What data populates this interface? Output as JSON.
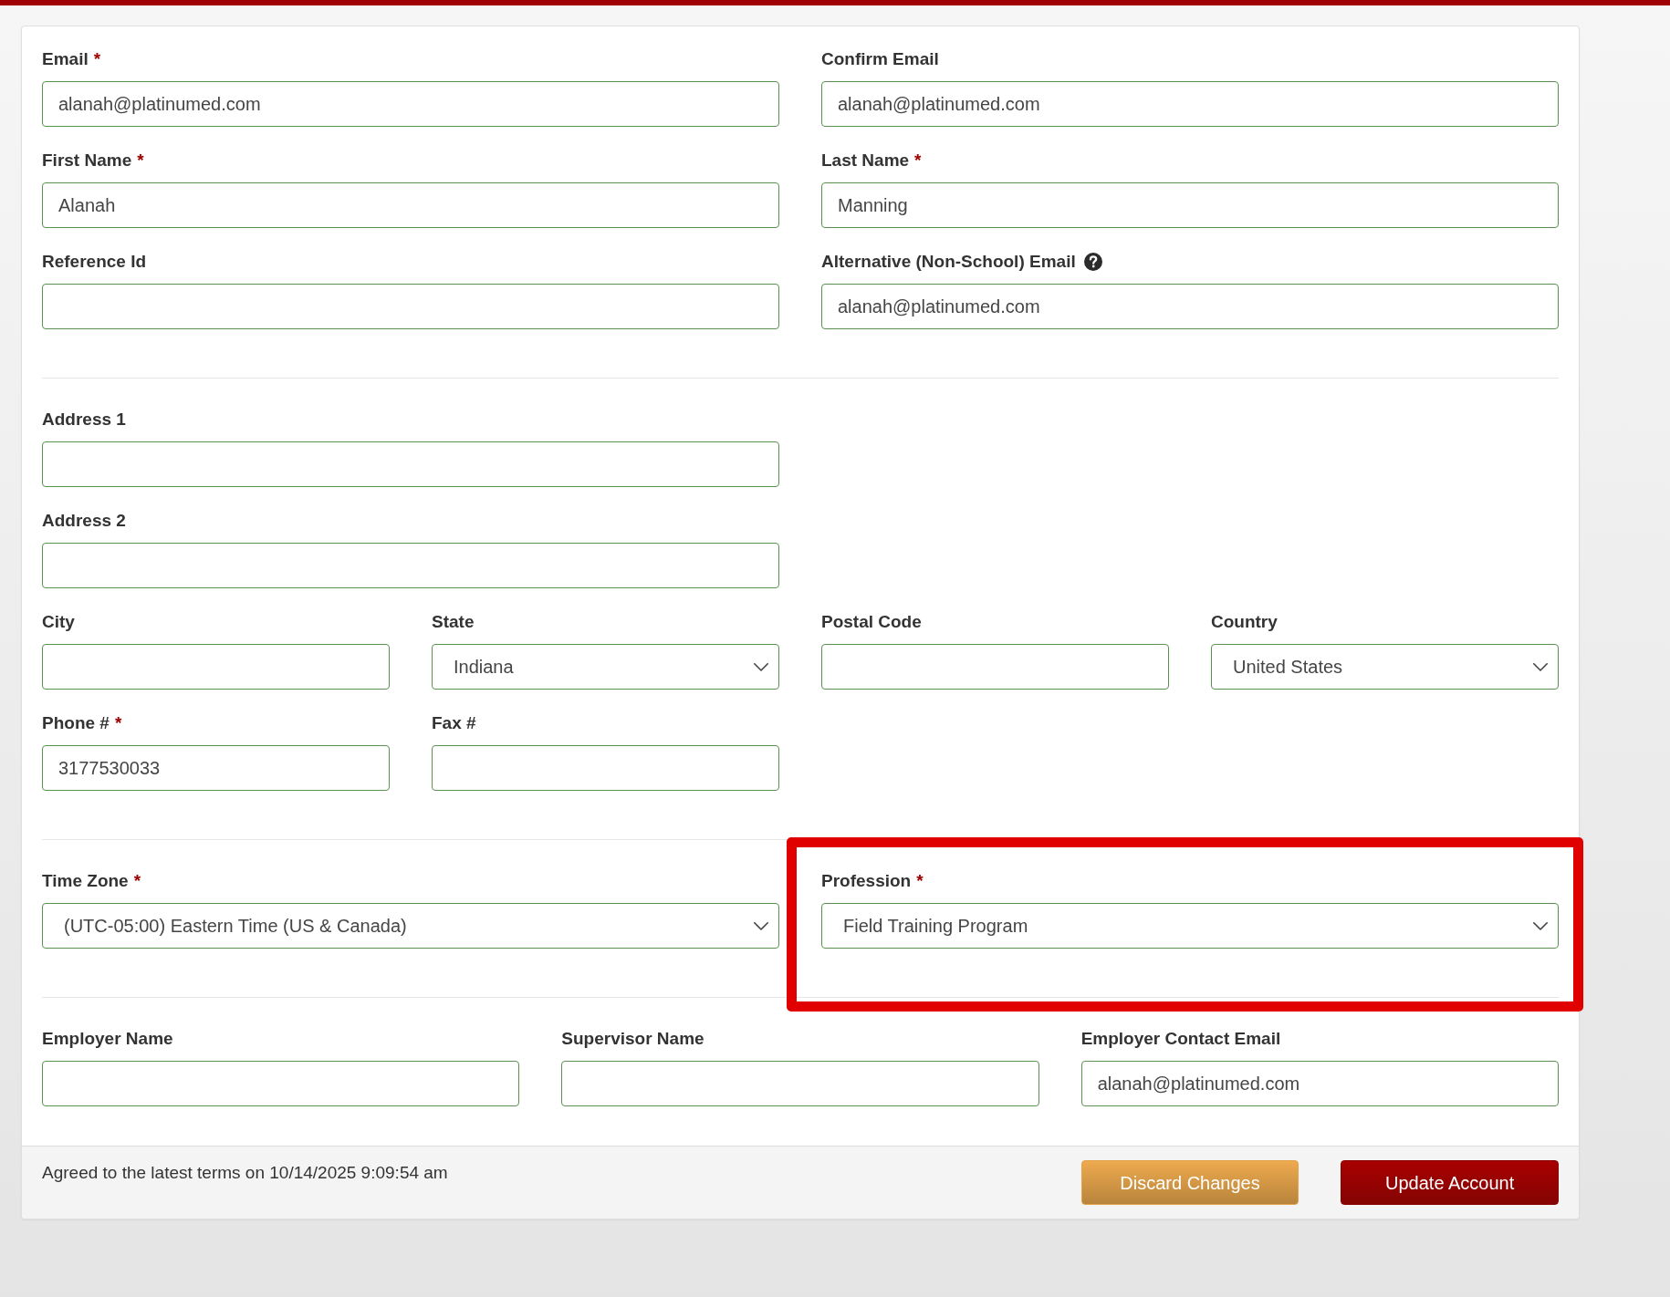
{
  "form": {
    "sections": [
      {
        "rows": [
          {
            "kind": "halves",
            "fields": [
              {
                "kind": "text",
                "label": "Email",
                "required_mark": "*",
                "value": "alanah@platinumed.com"
              },
              {
                "kind": "text",
                "label": "Confirm Email",
                "value": "alanah@platinumed.com"
              }
            ]
          },
          {
            "kind": "halves",
            "fields": [
              {
                "kind": "text",
                "label": "First Name",
                "required_mark": "*",
                "value": "Alanah"
              },
              {
                "kind": "text",
                "label": "Last Name",
                "required_mark": "*",
                "value": "Manning"
              }
            ]
          },
          {
            "kind": "halves",
            "fields": [
              {
                "kind": "text",
                "label": "Reference Id"
              },
              {
                "kind": "text",
                "label": "Alternative (Non-School) Email",
                "help": true,
                "value": "alanah@platinumed.com"
              }
            ]
          }
        ]
      },
      {
        "rows": [
          {
            "kind": "halves",
            "fields": [
              {
                "kind": "text",
                "label": "Address 1"
              }
            ]
          },
          {
            "kind": "halves",
            "fields": [
              {
                "kind": "text",
                "label": "Address 2"
              }
            ]
          },
          {
            "kind": "quarters",
            "fields": [
              {
                "kind": "text",
                "label": "City"
              },
              {
                "kind": "select",
                "label": "State",
                "value": "Indiana"
              },
              {
                "kind": "text",
                "label": "Postal Code"
              },
              {
                "kind": "select",
                "label": "Country",
                "value": "United States"
              }
            ]
          },
          {
            "kind": "quarters",
            "fields": [
              {
                "kind": "text",
                "label": "Phone #",
                "required_mark": "*",
                "value": "3177530033"
              },
              {
                "kind": "text",
                "label": "Fax #"
              }
            ]
          }
        ]
      },
      {
        "rows": [
          {
            "kind": "halves",
            "fields": [
              {
                "kind": "select",
                "label": "Time Zone",
                "required_mark": "*",
                "value": "(UTC-05:00) Eastern Time (US & Canada)"
              },
              {
                "kind": "select",
                "label": "Profession",
                "required_mark": "*",
                "value": "Field Training Program",
                "highlighted": true
              }
            ]
          }
        ]
      },
      {
        "rows": [
          {
            "kind": "thirds",
            "fields": [
              {
                "kind": "text",
                "label": "Employer Name"
              },
              {
                "kind": "text",
                "label": "Supervisor Name"
              },
              {
                "kind": "text",
                "label": "Employer Contact Email",
                "value": "alanah@platinumed.com"
              }
            ]
          }
        ]
      }
    ]
  },
  "footer": {
    "terms_note": "Agreed to the latest terms on 10/14/2025 9:09:54 am",
    "buttons": [
      {
        "label": "Discard Changes",
        "kind": "secondary"
      },
      {
        "label": "Update Account",
        "kind": "primary"
      }
    ]
  }
}
